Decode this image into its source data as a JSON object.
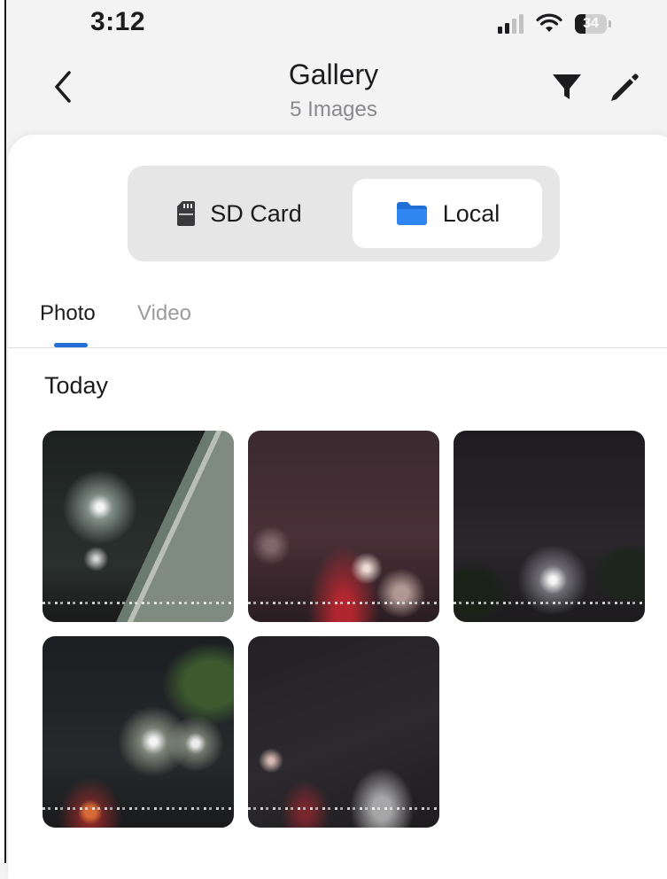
{
  "status_bar": {
    "time": "3:12",
    "battery": "34",
    "battery_level": 0.34
  },
  "header": {
    "title": "Gallery",
    "subtitle": "5 Images",
    "back_icon": "chevron-left-icon",
    "filter_icon": "filter-icon",
    "edit_icon": "pencil-icon"
  },
  "source_switch": {
    "options": [
      {
        "label": "SD Card",
        "icon": "sd-card-icon"
      },
      {
        "label": "Local",
        "icon": "folder-icon",
        "icon_color": "#1f6fd6"
      }
    ],
    "selected": "Local"
  },
  "tabs": [
    {
      "label": "Photo",
      "active": true
    },
    {
      "label": "Video",
      "active": false
    }
  ],
  "accent_color": "#1f6fd6",
  "section_title": "Today",
  "images": [
    {
      "type": "photo"
    },
    {
      "type": "photo"
    },
    {
      "type": "photo"
    },
    {
      "type": "photo"
    },
    {
      "type": "photo"
    }
  ]
}
